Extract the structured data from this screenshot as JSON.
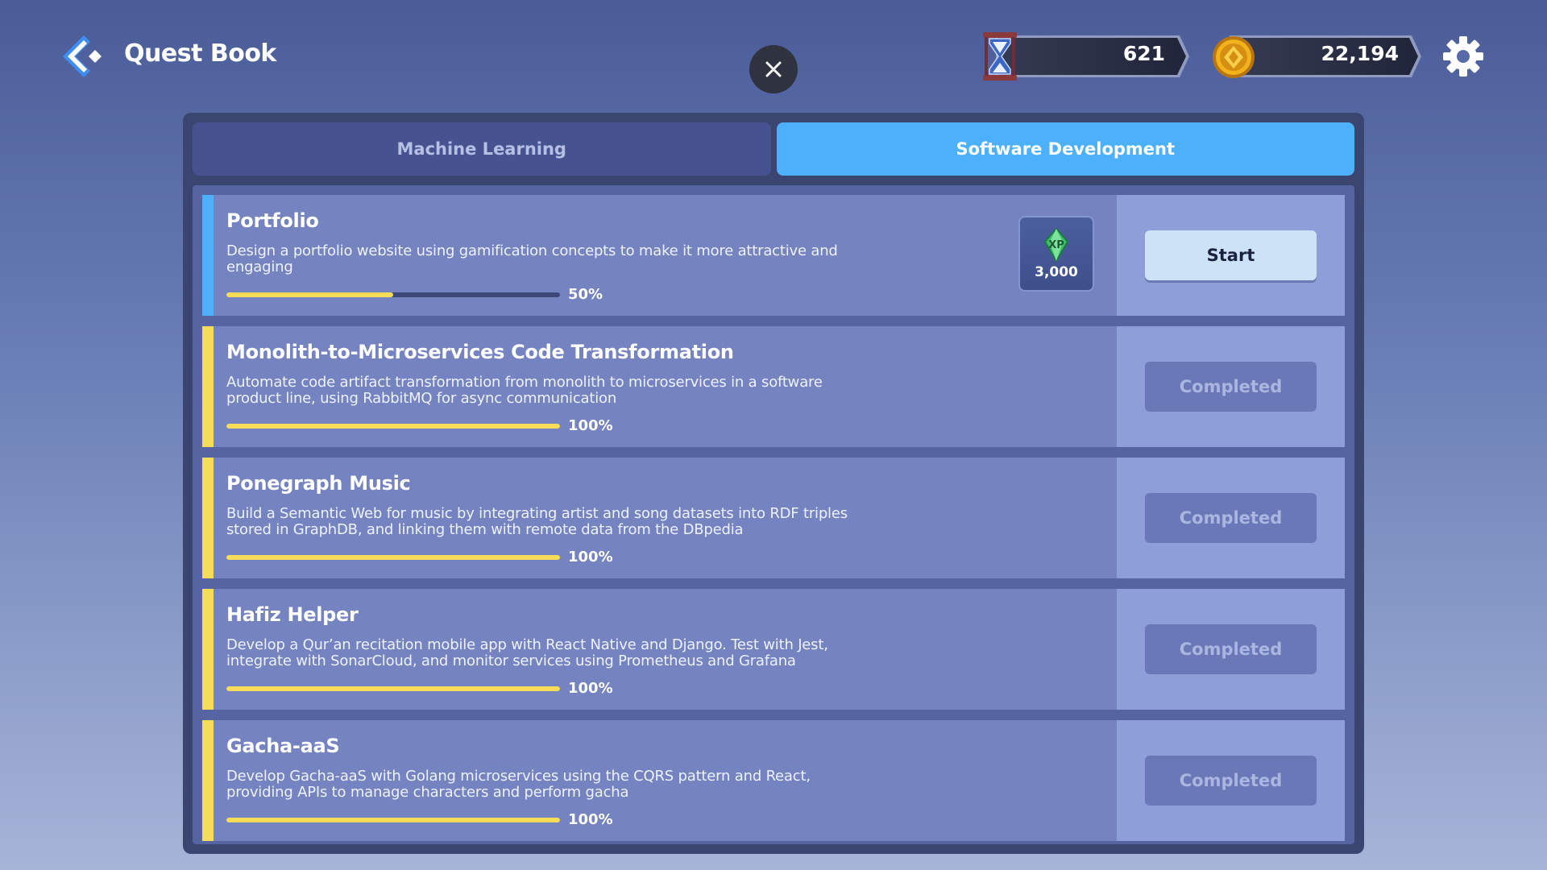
{
  "header": {
    "title": "Quest Book",
    "timer_value": "621",
    "coins_value": "22,194"
  },
  "tabs": [
    {
      "label": "Machine Learning",
      "active": false
    },
    {
      "label": "Software Development",
      "active": true
    }
  ],
  "colors": {
    "accent_blue": "#4db0fb",
    "progress_yellow": "#f7dc5a",
    "active_stripe": "#4db0fb",
    "completed_stripe": "#f7dc5a"
  },
  "quests": [
    {
      "title": "Portfolio",
      "description": "Design a portfolio website using gamification concepts to make it more attractive and engaging",
      "progress": 50,
      "progress_label": "50%",
      "reward": {
        "icon": "xp-crystal-icon",
        "value": "3,000"
      },
      "action_label": "Start",
      "status": "active"
    },
    {
      "title": "Monolith-to-Microservices Code Transformation",
      "description": "Automate code artifact transformation from monolith to microservices in a software product line, using RabbitMQ for async communication",
      "progress": 100,
      "progress_label": "100%",
      "action_label": "Completed",
      "status": "completed"
    },
    {
      "title": "Ponegraph Music",
      "description": "Build a Semantic Web for music by integrating artist and song datasets into RDF triples stored in GraphDB, and linking them with remote data from the DBpedia",
      "progress": 100,
      "progress_label": "100%",
      "action_label": "Completed",
      "status": "completed"
    },
    {
      "title": "Hafiz Helper",
      "description": "Develop a Qur’an recitation mobile app with React Native and Django. Test with Jest, integrate with SonarCloud, and monitor services using Prometheus and Grafana",
      "progress": 100,
      "progress_label": "100%",
      "action_label": "Completed",
      "status": "completed"
    },
    {
      "title": "Gacha-aaS",
      "description": "Develop Gacha-aaS with Golang microservices using the CQRS pattern and React, providing APIs to manage characters and perform gacha",
      "progress": 100,
      "progress_label": "100%",
      "action_label": "Completed",
      "status": "completed"
    }
  ]
}
